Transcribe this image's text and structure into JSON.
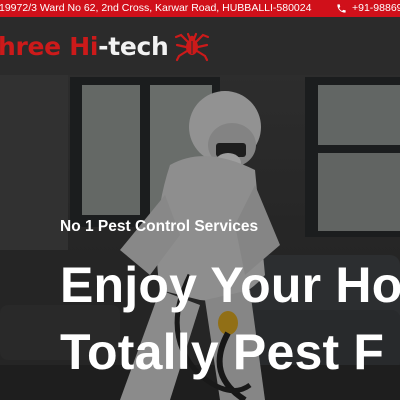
{
  "topbar": {
    "address": "19972/3 Ward No 62, 2nd Cross, Karwar Road, HUBBALLI-580024",
    "phone": "+91-98869",
    "phone_icon": "phone-icon",
    "background": "#d0101a"
  },
  "header": {
    "logo_red": "hree Hi",
    "logo_white": "-tech",
    "logo_icon": "bug-icon",
    "brand_red": "#cc1a1a"
  },
  "hero": {
    "tagline": "No 1 Pest Control Services",
    "headline_line1": "Enjoy Your Ho",
    "headline_line2": "Totally Pest F"
  }
}
